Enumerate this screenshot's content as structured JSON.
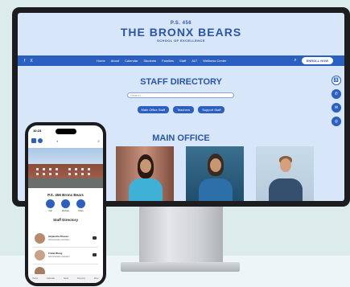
{
  "website": {
    "logo": {
      "top": "P.S. 456",
      "main": "THE BRONX BEARS",
      "sub": "SCHOOL OF EXCELLENCE"
    },
    "nav": {
      "social": [
        "f",
        "X"
      ],
      "items": [
        "Home",
        "About",
        "Calendar",
        "Students",
        "Families",
        "Staff",
        "ALT",
        "Wellness Center"
      ],
      "enroll_label": "ENROLL NOW"
    },
    "staff_directory": {
      "title": "STAFF DIRECTORY",
      "search_placeholder": "Search...",
      "filters": [
        "Main Office Staff",
        "Teachers",
        "Support Staff"
      ]
    },
    "main_office": {
      "title": "MAIN OFFICE"
    },
    "colors": {
      "brand": "#2b5fc0",
      "page_bg": "#d7e6f8"
    }
  },
  "phone": {
    "status_time": "10:23",
    "school_name": "P.S. 456 Bronx Bears",
    "quick_actions": [
      "Call",
      "Website",
      "Share"
    ],
    "directory_title": "Staff Directory",
    "staff": [
      {
        "name": "Alejandra Alvarez",
        "role": "Administrative Assistant"
      },
      {
        "name": "Frank Wong",
        "role": "Administrative Assistant"
      },
      {
        "name": "",
        "role": ""
      }
    ],
    "tabs": [
      "Home",
      "Calendar",
      "News",
      "Directory",
      "More"
    ]
  }
}
